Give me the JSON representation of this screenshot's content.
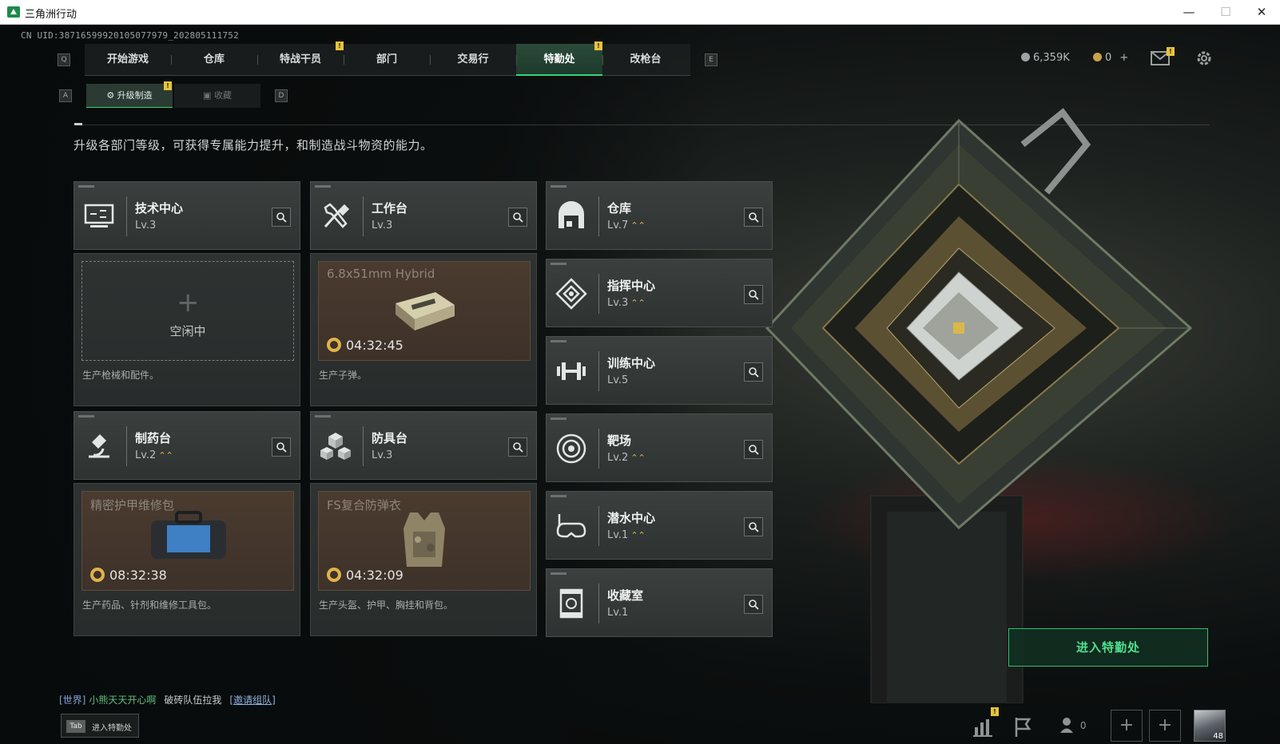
{
  "window": {
    "title": "三角洲行动",
    "min": "—",
    "max": "☐",
    "close": "✕"
  },
  "uid": "CN UID:38716599920105077979_202805111752",
  "nav": {
    "left_key": "Q",
    "right_key": "E",
    "tabs": [
      "开始游戏",
      "仓库",
      "特战干员",
      "部门",
      "交易行",
      "特勤处",
      "改枪台"
    ],
    "active_index": 5
  },
  "subnav": {
    "left_key": "A",
    "right_key": "D",
    "tabs": [
      "升级制造",
      "收藏"
    ],
    "active_index": 0
  },
  "currency": {
    "silver": "6,359K",
    "gold": "0",
    "gold_add": "+"
  },
  "badge_mark": "!",
  "description": "升级各部门等级，可获得专属能力提升，和制造战斗物资的能力。",
  "level_up_mark": "⌃⌃",
  "facilities": {
    "tech": {
      "name": "技术中心",
      "level": "Lv.3"
    },
    "workbench": {
      "name": "工作台",
      "level": "Lv.3"
    },
    "warehouse": {
      "name": "仓库",
      "level": "Lv.7"
    },
    "command": {
      "name": "指挥中心",
      "level": "Lv.3"
    },
    "training": {
      "name": "训练中心",
      "level": "Lv.5"
    },
    "pharmacy": {
      "name": "制药台",
      "level": "Lv.2"
    },
    "armor": {
      "name": "防具台",
      "level": "Lv.3"
    },
    "range": {
      "name": "靶场",
      "level": "Lv.2"
    },
    "diving": {
      "name": "潜水中心",
      "level": "Lv.1"
    },
    "collection": {
      "name": "收藏室",
      "level": "Lv.1"
    }
  },
  "production": {
    "tech": {
      "idle_plus": "+",
      "idle_label": "空闲中",
      "note": "生产枪械和配件。"
    },
    "workbench": {
      "item": "6.8x51mm Hybrid",
      "timer": "04:32:45",
      "note": "生产子弹。"
    },
    "pharmacy": {
      "item": "精密护甲维修包",
      "timer": "08:32:38",
      "note": "生产药品、针剂和维修工具包。"
    },
    "armor": {
      "item": "FS复合防弹衣",
      "timer": "04:32:09",
      "note": "生产头盔、护甲、胸挂和背包。"
    }
  },
  "enter_button": "进入特勤处",
  "chat": {
    "channel": "[世界]",
    "sender": "小熊天天开心啊",
    "message": "破砖队伍拉我",
    "invite": "[邀请组队]"
  },
  "tab_hint": {
    "key": "Tab",
    "label": "进入特勤处"
  },
  "bottom": {
    "friends_count": "0",
    "add": "+",
    "avatar_level": "48"
  },
  "colors": {
    "accent_green": "#35d47a",
    "badge_yellow": "#e8c23a",
    "level_up": "#e2b64a",
    "production_bg": "#4b3b2f"
  }
}
